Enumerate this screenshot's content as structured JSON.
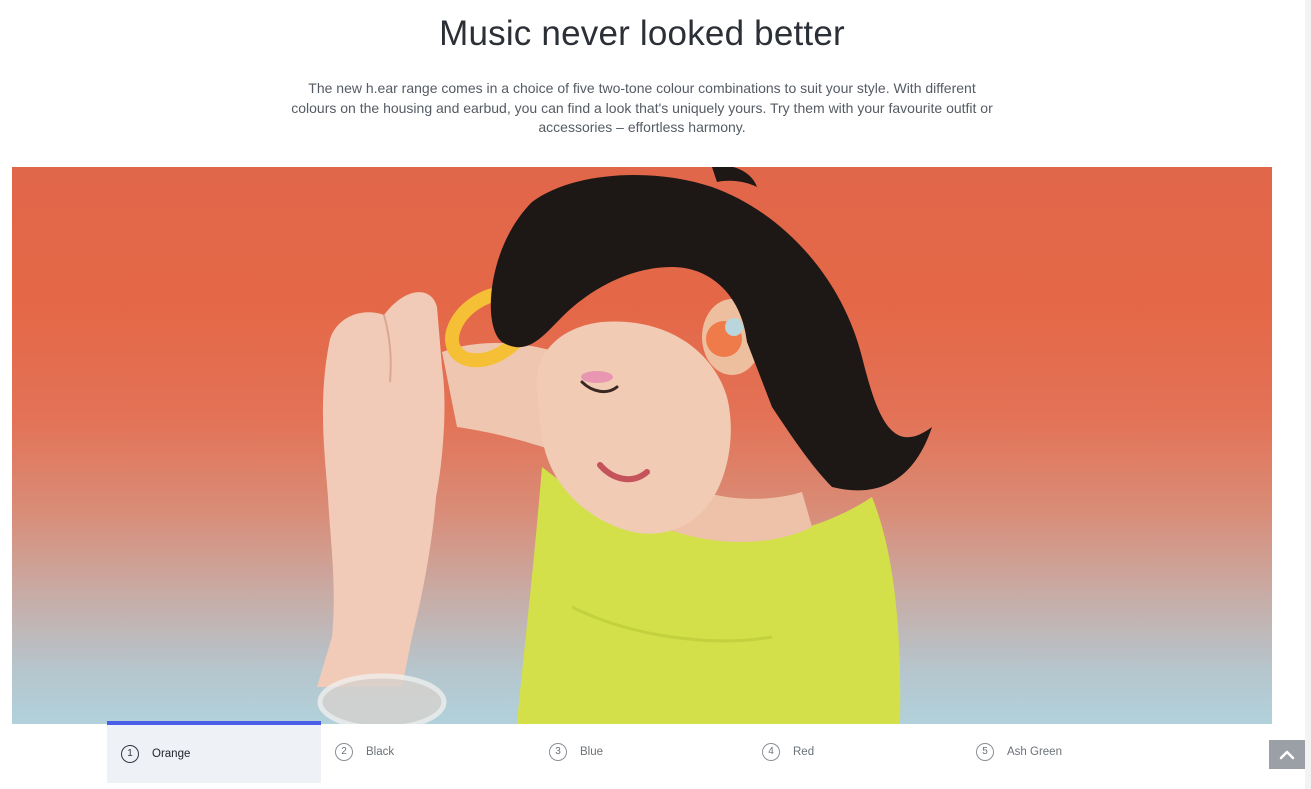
{
  "section": {
    "title": "Music never looked better",
    "description": "The new h.ear range comes in a choice of five two-tone colour combinations to suit your style. With different colours on the housing and earbud, you can find a look that's uniquely yours. Try them with your favourite outfit or accessories – effortless harmony."
  },
  "hero": {
    "icon": "photo-woman-wearing-orange-earbuds",
    "colors": {
      "background_top": "#e1674a",
      "background_bottom": "#b1d1db",
      "shirt": "#d3e04a",
      "earbud": "#ef7a4a"
    }
  },
  "color_tabs": {
    "active_index": 0,
    "accent_color": "#4b5ee8",
    "items": [
      {
        "number": "1",
        "label": "Orange"
      },
      {
        "number": "2",
        "label": "Black"
      },
      {
        "number": "3",
        "label": "Blue"
      },
      {
        "number": "4",
        "label": "Red"
      },
      {
        "number": "5",
        "label": "Ash Green"
      }
    ]
  },
  "back_to_top": {
    "icon": "chevron-up-icon"
  }
}
